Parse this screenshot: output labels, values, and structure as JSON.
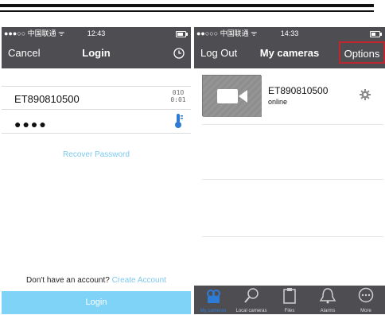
{
  "login_screen": {
    "status": {
      "carrier": "●●●○○ 中国联通 ᯤ",
      "time": "12:43",
      "battery_level": 0.7
    },
    "nav": {
      "cancel_label": "Cancel",
      "title": "Login",
      "history_icon": "clock-icon"
    },
    "username_value": "ET890810500",
    "password_value": "●●●●",
    "qr_icon": "qr-scan-icon",
    "password_icon": "key-icon",
    "recover_label": "Recover Password",
    "no_account_label": "Don't have an account?",
    "create_account_label": "Create Account",
    "login_label": "Login",
    "accent_color": "#7fd3f6"
  },
  "cameras_screen": {
    "status": {
      "carrier": "●●○○○ 中国联通 ᯤ",
      "time": "14:33",
      "battery_level": 0.5
    },
    "nav": {
      "logout_label": "Log Out",
      "title": "My cameras",
      "options_label": "Options"
    },
    "cameras": [
      {
        "name": "ET890810500",
        "status": "online",
        "thumbnail_icon": "video-camera-icon",
        "settings_icon": "gear-icon"
      }
    ],
    "tabs": [
      {
        "label": "My cameras",
        "icon": "cameras-icon",
        "active": true
      },
      {
        "label": "Local cameras",
        "icon": "search-icon",
        "active": false
      },
      {
        "label": "Files",
        "icon": "clipboard-icon",
        "active": false
      },
      {
        "label": "Alarms",
        "icon": "bell-icon",
        "active": false
      },
      {
        "label": "More",
        "icon": "more-icon",
        "active": false
      }
    ],
    "highlight_color": "#c0262e"
  }
}
